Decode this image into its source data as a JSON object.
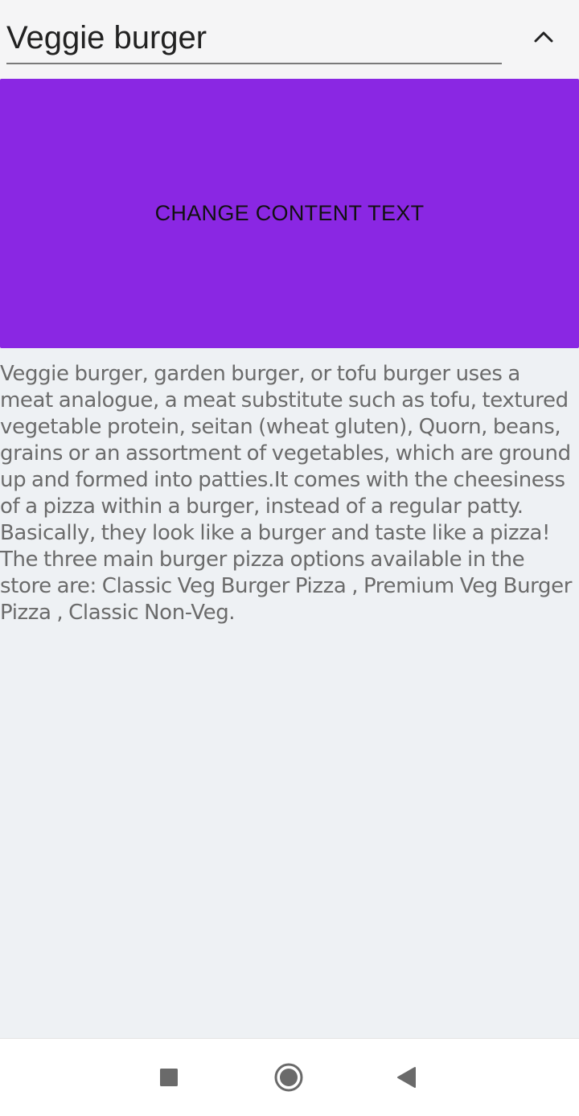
{
  "header": {
    "title": "Veggie burger",
    "collapse_icon": "chevron-up-icon"
  },
  "button": {
    "label": "CHANGE CONTENT TEXT",
    "color": "#8a27e3"
  },
  "content": {
    "text": "Veggie burger, garden burger, or tofu burger uses a meat analogue, a meat substitute such as tofu, textured vegetable protein, seitan (wheat gluten), Quorn, beans, grains or an assortment of vegetables, which are ground up and formed into patties.It comes with the cheesiness of a pizza within a burger, instead of a regular patty. Basically, they look like a burger and taste like a pizza! The three main burger pizza options available in the store are: Classic Veg Burger Pizza , Premium Veg Burger Pizza , Classic Non-Veg."
  },
  "navbar": {
    "recents_icon": "square-icon",
    "home_icon": "circle-icon",
    "back_icon": "triangle-back-icon"
  }
}
